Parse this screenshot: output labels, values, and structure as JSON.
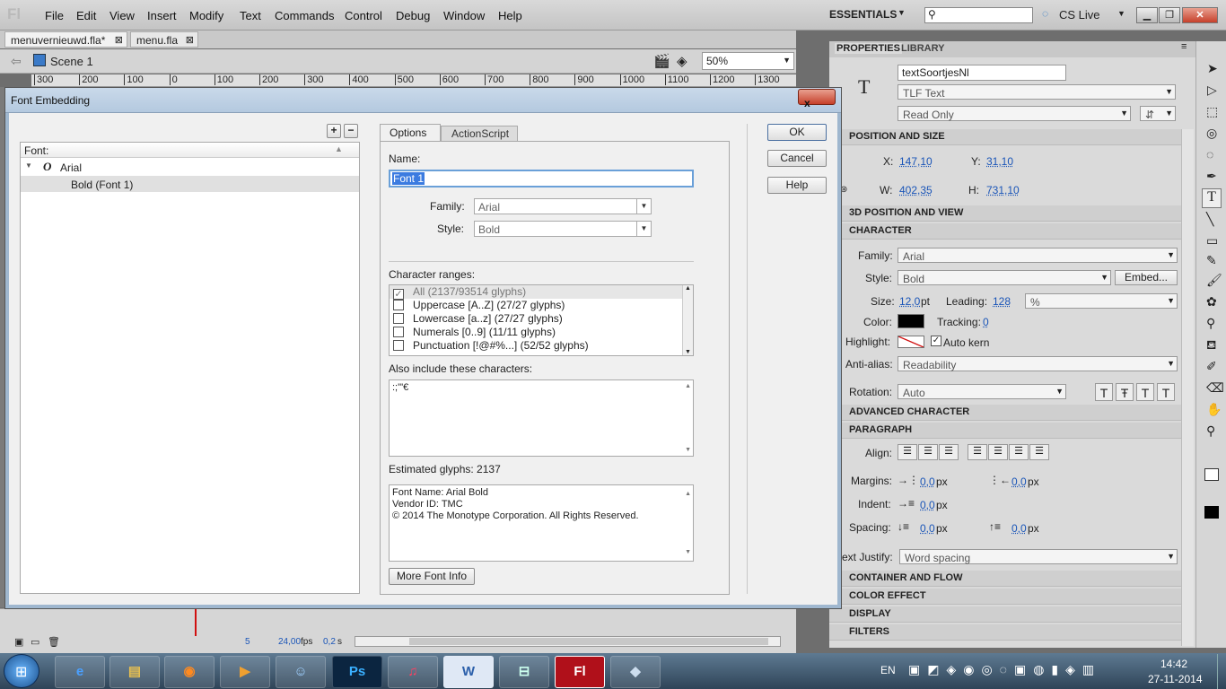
{
  "app": {
    "logo": "Fl"
  },
  "menu": {
    "items": [
      "File",
      "Edit",
      "View",
      "Insert",
      "Modify",
      "Text",
      "Commands",
      "Control",
      "Debug",
      "Window",
      "Help"
    ],
    "workspace": "ESSENTIALS",
    "cslive": "CS Live"
  },
  "doc_tabs": [
    "menuvernieuwd.fla*",
    "menu.fla"
  ],
  "scene": {
    "label": "Scene 1",
    "zoom": "50%"
  },
  "ruler": [
    "300",
    "200",
    "100",
    "0",
    "100",
    "200",
    "300",
    "400",
    "500",
    "600",
    "700",
    "800",
    "900",
    "1000",
    "1100",
    "1200",
    "1300"
  ],
  "dialog": {
    "title": "Font Embedding",
    "close": "x",
    "font_header": "Font:",
    "fonts": [
      {
        "label": "Arial",
        "children": [
          "Bold (Font 1)"
        ]
      }
    ],
    "tabs": [
      "Options",
      "ActionScript"
    ],
    "name_label": "Name:",
    "name_value": "Font 1",
    "family_label": "Family:",
    "family_value": "Arial",
    "style_label": "Style:",
    "style_value": "Bold",
    "ranges_label": "Character ranges:",
    "ranges": [
      {
        "label": "All  (2137/93514 glyphs)",
        "checked": true
      },
      {
        "label": "Uppercase [A..Z]  (27/27 glyphs)",
        "checked": false
      },
      {
        "label": "Lowercase [a..z]  (27/27 glyphs)",
        "checked": false
      },
      {
        "label": "Numerals [0..9]  (11/11 glyphs)",
        "checked": false
      },
      {
        "label": "Punctuation [!@#%...]  (52/52 glyphs)",
        "checked": false
      }
    ],
    "include_label": "Also include these characters:",
    "include_value": ":;'\"€",
    "estimated": "Estimated glyphs: 2137",
    "font_info": [
      "Font Name: Arial Bold",
      "Vendor ID: TMC",
      "© 2014 The Monotype Corporation. All Rights Reserved."
    ],
    "more_info": "More Font Info",
    "ok": "OK",
    "cancel": "Cancel",
    "help": "Help"
  },
  "properties": {
    "tabs": [
      "PROPERTIES",
      "LIBRARY"
    ],
    "instance_name": "textSoortjesNl",
    "text_type": "TLF Text",
    "behavior": "Read Only",
    "sections": {
      "pos": "POSITION AND SIZE",
      "pos3d": "3D POSITION AND VIEW",
      "char": "CHARACTER",
      "adv": "ADVANCED CHARACTER",
      "para": "PARAGRAPH",
      "cont": "CONTAINER AND FLOW",
      "color": "COLOR EFFECT",
      "disp": "DISPLAY",
      "filt": "FILTERS"
    },
    "x": "147,10",
    "y": "31,10",
    "w": "402,35",
    "h": "731,10",
    "family": "Arial",
    "style": "Bold",
    "embed": "Embed...",
    "size": "12,0",
    "size_unit": "pt",
    "leading": "128",
    "leading_unit": "%",
    "tracking": "0",
    "autokern": "Auto kern",
    "antialias": "Readability",
    "rotation": "Auto",
    "margin1": "0,0",
    "margin2": "0,0",
    "indent": "0,0",
    "spacing1": "0,0",
    "spacing2": "0,0",
    "px": "px",
    "justify": "Word spacing",
    "labels": {
      "x": "X:",
      "y": "Y:",
      "w": "W:",
      "h": "H:",
      "family": "Family:",
      "style": "Style:",
      "size": "Size:",
      "leading": "Leading:",
      "color": "Color:",
      "tracking": "Tracking:",
      "highlight": "Highlight:",
      "antialias": "Anti-alias:",
      "rotation": "Rotation:",
      "align": "Align:",
      "margins": "Margins:",
      "indent": "Indent:",
      "spacing": "Spacing:",
      "justify": "ext Justify:"
    }
  },
  "timeline": {
    "frame": "5",
    "fps": "24,00",
    "fps_unit": "fps",
    "time": "0,2",
    "time_unit": "s"
  },
  "taskbar": {
    "lang": "EN",
    "time": "14:42",
    "date": "27-11-2014"
  },
  "colors": {
    "accent": "#1a55b8",
    "text_color": "#000000"
  }
}
